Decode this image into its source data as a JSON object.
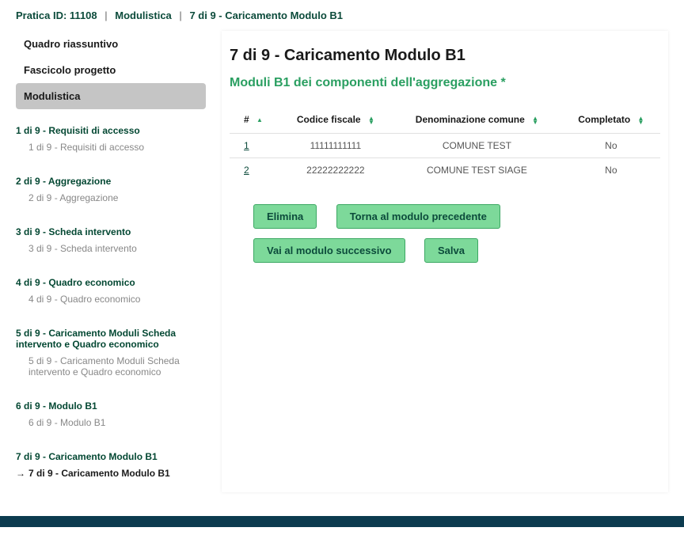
{
  "breadcrumb": {
    "pratica": "Pratica ID: 11108",
    "modulistica": "Modulistica",
    "step": "7 di 9 - Caricamento Modulo B1"
  },
  "sidebar": {
    "quadro": "Quadro riassuntivo",
    "fascicolo": "Fascicolo progetto",
    "modulistica": "Modulistica",
    "steps": [
      {
        "title": "1 di 9 - Requisiti di accesso",
        "sub": "1 di 9 - Requisiti di accesso"
      },
      {
        "title": "2 di 9 - Aggregazione",
        "sub": "2 di 9 - Aggregazione"
      },
      {
        "title": "3 di 9 - Scheda intervento",
        "sub": "3 di 9 - Scheda intervento"
      },
      {
        "title": "4 di 9 - Quadro economico",
        "sub": "4 di 9 - Quadro economico"
      },
      {
        "title": "5 di 9 - Caricamento Moduli Scheda intervento e Quadro economico",
        "sub": "5 di 9 - Caricamento Moduli Scheda intervento e Quadro economico"
      },
      {
        "title": "6 di 9 - Modulo B1",
        "sub": "6 di 9 - Modulo B1"
      },
      {
        "title": "7 di 9 - Caricamento Modulo B1",
        "sub": "7 di 9 - Caricamento Modulo B1"
      }
    ]
  },
  "main": {
    "title": "7 di 9 - Caricamento Modulo B1",
    "subtitle": "Moduli B1 dei componenti dell'aggregazione *",
    "headers": {
      "num": "#",
      "cf": "Codice fiscale",
      "denom": "Denominazione comune",
      "compl": "Completato"
    },
    "rows": [
      {
        "num": "1",
        "cf": "11111111111",
        "denom": "COMUNE TEST",
        "compl": "No"
      },
      {
        "num": "2",
        "cf": "22222222222",
        "denom": "COMUNE TEST SIAGE",
        "compl": "No"
      }
    ],
    "buttons": {
      "elimina": "Elimina",
      "precedente": "Torna al modulo precedente",
      "successivo": "Vai al modulo successivo",
      "salva": "Salva"
    }
  }
}
